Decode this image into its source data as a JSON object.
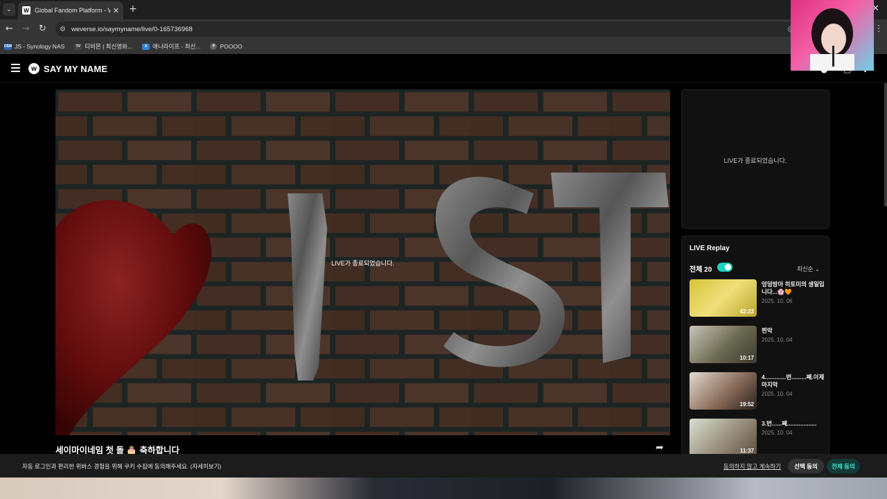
{
  "browser": {
    "tab_title": "Global Fandom Platform - Weverse",
    "tab_icon_letter": "W",
    "new_tab": "+",
    "url": "weverse.io/saymyname/live/0-165736968",
    "bookmarks": [
      {
        "label": "JS - Synology NAS",
        "icon_text": "DSM",
        "color": "#2a63b8"
      },
      {
        "label": "티비몬 | 최신영화...",
        "icon_text": "TV",
        "color": "#444"
      },
      {
        "label": "애니라이프 - 최신...",
        "icon_text": "A",
        "color": "#2f7fd6"
      },
      {
        "label": "POOOO",
        "icon_text": "P",
        "color": "#666"
      }
    ]
  },
  "site": {
    "brand": "SAY MY NAME",
    "logo_letter": "w"
  },
  "video": {
    "status_message": "LIVE가 종료되었습니다.",
    "title": "세이마이네임 첫 돌 🎂 축하합니다"
  },
  "chat": {
    "status_message": "LIVE가 종료되었습니다."
  },
  "replay": {
    "title": "LIVE Replay",
    "count_label": "전체 20",
    "sort_label": "최신순",
    "items": [
      {
        "title": "엉덩방아 히토미의 생일입니다...🌸🧡",
        "date": "2025. 10. 06",
        "duration": "42:23",
        "thumb": "linear-gradient(135deg,#d8c23a,#efe07a 50%,#b9a52c)"
      },
      {
        "title": "찐막",
        "date": "2025. 10. 04",
        "duration": "10:17",
        "thumb": "linear-gradient(135deg,#c9c4b8,#6b6a52 55%,#3d3a2e)"
      },
      {
        "title": "4.............번.........째.이제마지막",
        "date": "2025. 10. 04",
        "duration": "19:52",
        "thumb": "linear-gradient(135deg,#e3d9cf,#8a6d5b 55%,#2a211d)"
      },
      {
        "title": "3.번......째..................",
        "date": "2025. 10. 04",
        "duration": "11:37",
        "thumb": "linear-gradient(135deg,#d7e0d0,#9a8e7d 55%,#5b4d40)"
      }
    ]
  },
  "cookie": {
    "text": "자동 로그인과 편리한 위버스 경험을 위해 쿠키 수집에 동의해주세요. (자세히보기)",
    "decline_link": "동의하지 않고 계속하기",
    "select_button": "선택 동의",
    "accept_button": "전체 동의"
  },
  "icons": {
    "back": "back-arrow-icon",
    "forward": "forward-arrow-icon",
    "reload": "reload-icon",
    "share": "share-icon"
  },
  "colors": {
    "accent": "#1fd1c3",
    "background": "#000000"
  }
}
